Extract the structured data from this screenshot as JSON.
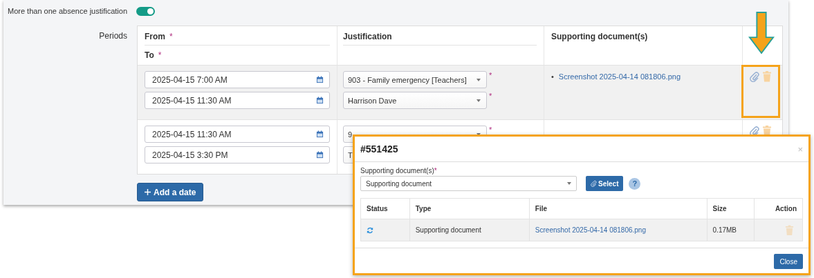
{
  "toggle": {
    "label": "More than one absence justification",
    "on": true
  },
  "periods": {
    "label": "Periods",
    "headers": {
      "from": {
        "label": "From",
        "mark": "*"
      },
      "to": {
        "label": "To",
        "mark": "*"
      },
      "justification": "Justification",
      "documents": "Supporting document(s)"
    },
    "rows": [
      {
        "highlighted": true,
        "from": "2025-04-15 7:00 AM",
        "to": "2025-04-15 11:30 AM",
        "justification": {
          "value": "903 - Family emergency [Teachers]",
          "mark": "*"
        },
        "person": {
          "value": "Harrison Dave",
          "mark": "*"
        },
        "documents": [
          {
            "bullet": "•",
            "name": "Screenshot 2025-04-14 081806.png"
          }
        ]
      },
      {
        "highlighted": false,
        "from": "2025-04-15 11:30 AM",
        "to": "2025-04-15 3:30 PM",
        "justification": {
          "value": "9",
          "mark": "*"
        },
        "person": {
          "value": "T"
        },
        "documents": []
      }
    ],
    "add_button": "Add a date"
  },
  "dialog": {
    "title": "#551425",
    "close": "×",
    "field": {
      "label": "Supporting document(s)",
      "mark": "*",
      "value": "Supporting document"
    },
    "select_button": "Select",
    "help": "?",
    "columns": [
      "Status",
      "Type",
      "File",
      "Size",
      "Action"
    ],
    "rows": [
      {
        "type": "Supporting document",
        "file": "Screenshot 2025-04-14 081806.png",
        "size": "0.17MB",
        "delete_disabled": true
      }
    ],
    "close_button": "Close"
  }
}
